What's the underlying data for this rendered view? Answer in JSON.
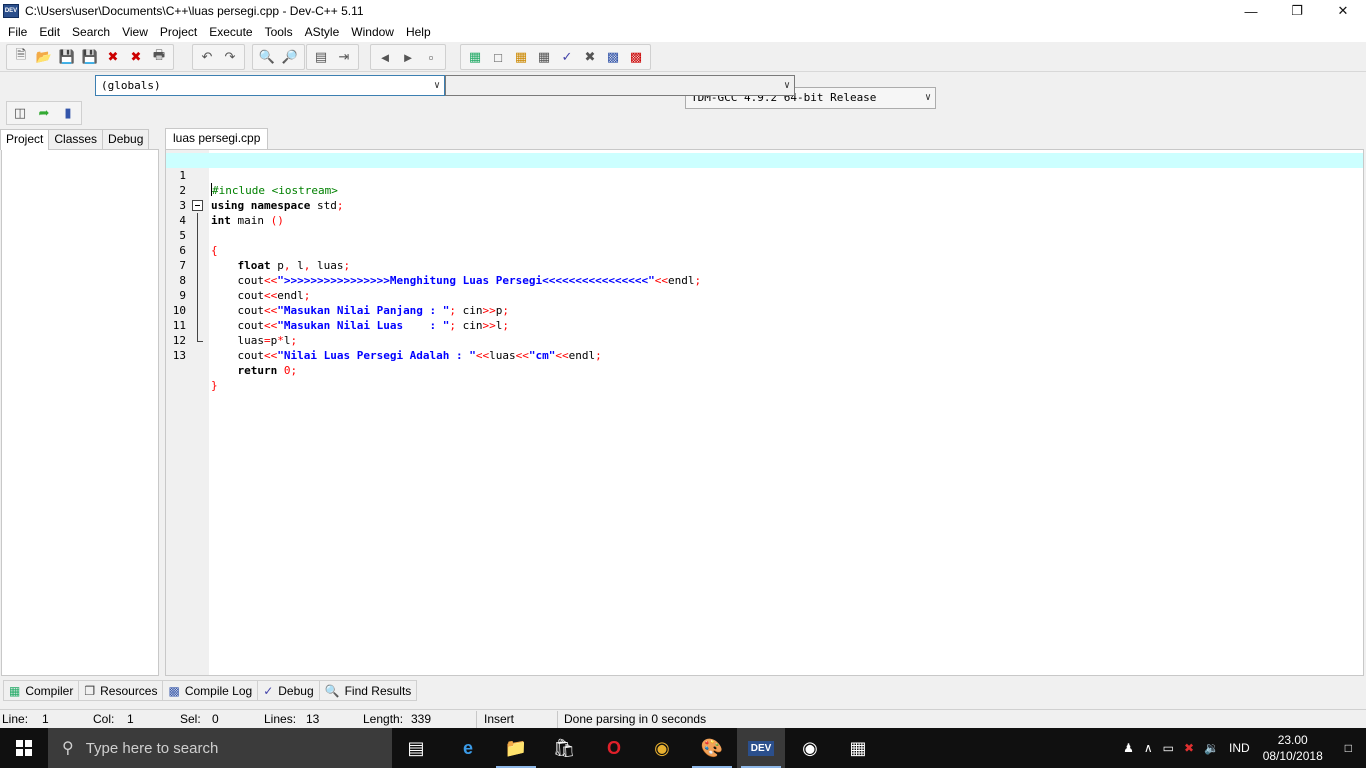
{
  "window": {
    "title": "C:\\Users\\user\\Documents\\C++\\luas persegi.cpp - Dev-C++ 5.11",
    "app_icon_text": "DEV"
  },
  "menu": [
    "File",
    "Edit",
    "Search",
    "View",
    "Project",
    "Execute",
    "Tools",
    "AStyle",
    "Window",
    "Help"
  ],
  "toolbar": {
    "compiler": "TDM-GCC 4.9.2 64-bit Release"
  },
  "scope": {
    "globals": "(globals)",
    "member": ""
  },
  "left_tabs": [
    "Project",
    "Classes",
    "Debug"
  ],
  "editor": {
    "tab": "luas persegi.cpp",
    "line_numbers": [
      "1",
      "2",
      "3",
      "4",
      "5",
      "6",
      "7",
      "8",
      "9",
      "10",
      "11",
      "12",
      "13"
    ]
  },
  "bottom_tabs": [
    "Compiler",
    "Resources",
    "Compile Log",
    "Debug",
    "Find Results"
  ],
  "status": {
    "line_label": "Line:",
    "line": "1",
    "col_label": "Col:",
    "col": "1",
    "sel_label": "Sel:",
    "sel": "0",
    "lines_label": "Lines:",
    "lines": "13",
    "length_label": "Length:",
    "length": "339",
    "mode": "Insert",
    "message": "Done parsing in 0 seconds"
  },
  "taskbar": {
    "search_placeholder": "Type here to search",
    "language": "IND",
    "time": "23.00",
    "date": "08/10/2018",
    "dev_label": "DEV"
  }
}
